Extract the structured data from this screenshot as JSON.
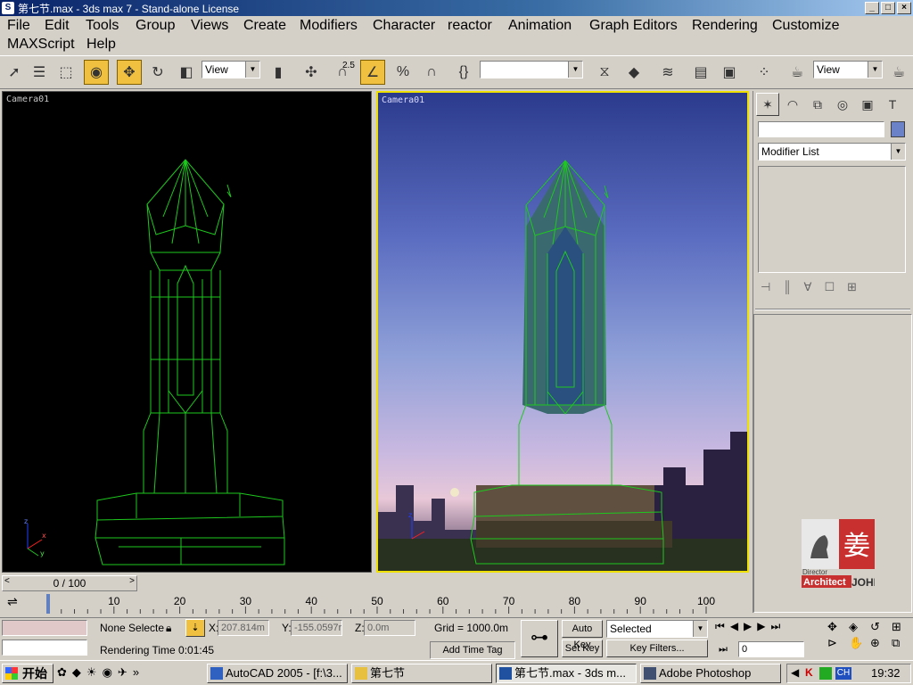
{
  "window": {
    "title": "第七节.max - 3ds max 7 - Stand-alone License",
    "min": "_",
    "max": "□",
    "close": "×"
  },
  "menu": {
    "row1": [
      "File",
      "Edit",
      "Tools",
      "Group",
      "Views",
      "Create",
      "Modifiers",
      "Character",
      "reactor",
      "Animation",
      "Graph Editors",
      "Rendering",
      "Customize"
    ],
    "row2": [
      "MAXScript",
      "Help"
    ]
  },
  "toolbar": {
    "ref_coord": "View",
    "named_selection": "",
    "render_view": "View",
    "snap_angle": "2.5",
    "icons": [
      "select-icon",
      "select-by-name-icon",
      "rect-region-icon",
      "window-crossing-icon",
      "move-icon",
      "rotate-icon",
      "scale-icon",
      "manipulate-icon",
      "snap-icon",
      "angle-snap-icon",
      "percent-snap-icon",
      "spinner-snap-icon",
      "named-sel-icon",
      "mirror-icon",
      "align-icon",
      "layer-icon",
      "curve-editor-icon",
      "schematic-icon",
      "material-editor-icon",
      "render-scene-icon",
      "quick-render-icon"
    ]
  },
  "viewports": {
    "left_label": "Camera01",
    "right_label": "Camera01"
  },
  "command_panel": {
    "modifier_list": "Modifier List",
    "tabs": [
      "create-icon",
      "modify-icon",
      "hierarchy-icon",
      "motion-icon",
      "display-icon",
      "utilities-icon"
    ],
    "logo": {
      "line1": "Director",
      "line2": "Architect",
      "line3": "JOHN",
      "glyph": "姜"
    }
  },
  "timeline": {
    "frame": "0 / 100",
    "ticks": [
      "0",
      "10",
      "20",
      "30",
      "40",
      "50",
      "60",
      "70",
      "80",
      "90",
      "100"
    ]
  },
  "status": {
    "selection": "None Selecte",
    "x_label": "X:",
    "x_value": "207.814m",
    "y_label": "Y:",
    "y_value": "-155.0597r",
    "z_label": "Z:",
    "z_value": "0.0m",
    "grid": "Grid = 1000.0m",
    "prompt": "Rendering Time  0:01:45",
    "add_time_tag": "Add Time Tag",
    "auto_key": "Auto Key",
    "set_key": "Set Key",
    "key_mode": "Selected",
    "key_filters": "Key Filters...",
    "current_frame": "0"
  },
  "taskbar": {
    "start": "开始",
    "tasks": [
      {
        "label": "AutoCAD 2005 - [f:\\3...",
        "active": false
      },
      {
        "label": "第七节",
        "active": false
      },
      {
        "label": "第七节.max - 3ds m...",
        "active": true
      },
      {
        "label": "Adobe Photoshop",
        "active": false
      }
    ],
    "tray_lang": "CH",
    "clock": "19:32"
  },
  "colors": {
    "wireframe": "#1ec81e",
    "active_viewport_border": "#f0e000",
    "selection_highlight": "#f0c040"
  }
}
